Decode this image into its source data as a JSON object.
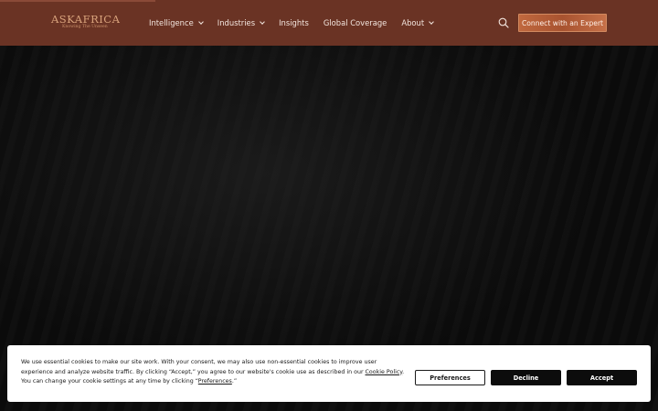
{
  "brand": {
    "name": "ASKAFRICA",
    "tagline": "Knowing The Unseen"
  },
  "nav": {
    "items": [
      {
        "label": "Intelligence",
        "has_dropdown": true
      },
      {
        "label": "Industries",
        "has_dropdown": true
      },
      {
        "label": "Insights",
        "has_dropdown": false
      },
      {
        "label": "Global Coverage",
        "has_dropdown": false
      },
      {
        "label": "About",
        "has_dropdown": true
      }
    ],
    "cta_label": "Connect with an Expert",
    "search_icon": "search-icon"
  },
  "cookie": {
    "text_1": "We use essential cookies to make our site work. With your consent, we may also use non-essential cookies to improve user experience and analyze website traffic. By clicking “Accept,” you agree to our website's cookie use as described in our ",
    "policy_link": "Cookie Policy",
    "text_2": ". You can change your cookie settings at any time by clicking “",
    "preferences_link": "Preferences",
    "text_3": ".”",
    "buttons": {
      "preferences": "Preferences",
      "decline": "Decline",
      "accept": "Accept"
    }
  },
  "colors": {
    "header_bg": "#6a3324",
    "accent": "#c0683e",
    "hero_bg": "#0b0b0b"
  }
}
